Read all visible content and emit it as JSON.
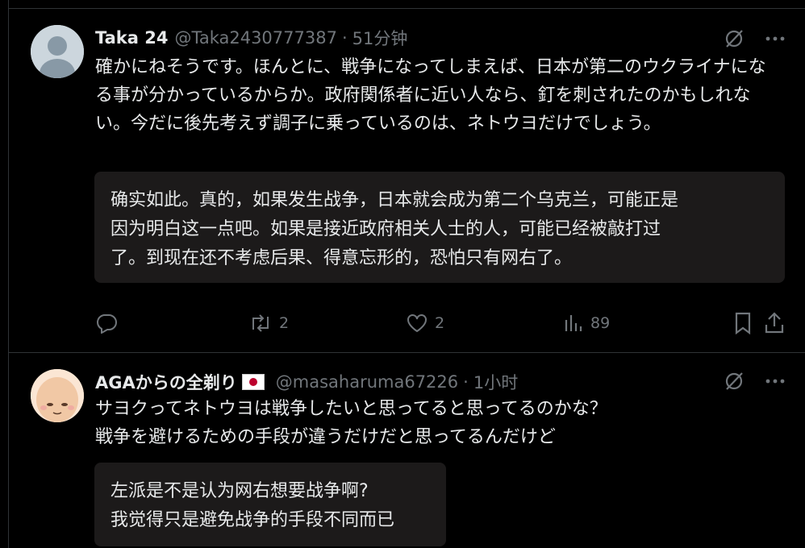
{
  "tweets": [
    {
      "display_name": "Taka 24",
      "handle": "@Taka2430777387",
      "separator": "·",
      "time": "51分钟",
      "text": "確かにねそうです。ほんとに、戦争になってしまえば、日本が第二のウクライナになる事が分かっているからか。政府関係者に近い人なら、釘を刺されたのかもしれない。今だに後先考えず調子に乗っているのは、ネトウヨだけでしょう。",
      "translation": "确实如此。真的，如果发生战争，日本就会成为第二个乌克兰，可能正是\n因为明白这一点吧。如果是接近政府相关人士的人，可能已经被敲打过\n了。到现在还不考虑后果、得意忘形的，恐怕只有网右了。",
      "actions": {
        "replies": "",
        "retweets": "2",
        "likes": "2",
        "views": "89"
      }
    },
    {
      "display_name": "AGAからの全剃り",
      "handle": "@masaharuma67226",
      "separator": "·",
      "time": "1小时",
      "text": "サヨクってネトウヨは戦争したいと思ってると思ってるのかな？\n戦争を避けるための手段が違うだけだと思ってるんだけど",
      "translation": "左派是不是认为网右想要战争啊?\n我觉得只是避免战争的手段不同而已"
    }
  ],
  "icons": {
    "grok": "grok-slash-icon",
    "more": "more-dots-icon",
    "reply": "reply-icon",
    "retweet": "retweet-icon",
    "like": "heart-icon",
    "views": "views-chart-icon",
    "bookmark": "bookmark-icon",
    "share": "share-icon"
  },
  "colors": {
    "background": "#000000",
    "text": "#e7e9ea",
    "muted": "#71767b",
    "translation_bg": "#1c1a1a",
    "border": "#2f3336"
  }
}
